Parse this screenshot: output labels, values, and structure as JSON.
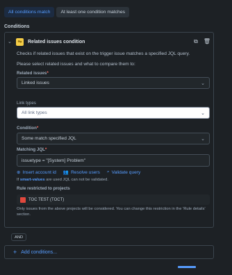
{
  "match_toggle": {
    "all_label": "All conditions match",
    "any_label": "At least one condition matches"
  },
  "section_title": "Conditions",
  "condition": {
    "title": "Related issues condition",
    "description": "Checks if related issues that exist on the trigger issue matches a specified JQL query.",
    "instruction": "Please select related issues and what to compare them to:",
    "related_issues": {
      "label": "Related issues",
      "value": "Linked issues"
    },
    "link_types": {
      "label": "Link types",
      "placeholder": "All link types"
    },
    "condition_field": {
      "label": "Condition",
      "value": "Some match specified JQL"
    },
    "matching_jql": {
      "label": "Matching JQL",
      "value": "issuetype = \"[System] Problem\""
    },
    "insert_account_id": "Insert account id",
    "resolve_users": "Resolve users",
    "validate_query": "Validate query",
    "hint_prefix": "If",
    "hint_link": "smart-values",
    "hint_suffix": "are used JQL can not be validated.",
    "rule_restricted_label": "Rule restricted to projects",
    "project_name": "TOC TEST (TOCT)",
    "note_line1": "Only issues from the above projects will be considered. You can change this restriction in the 'Rule details'",
    "note_line2": "section."
  },
  "and_label": "AND",
  "add_conditions_label": "Add conditions..."
}
